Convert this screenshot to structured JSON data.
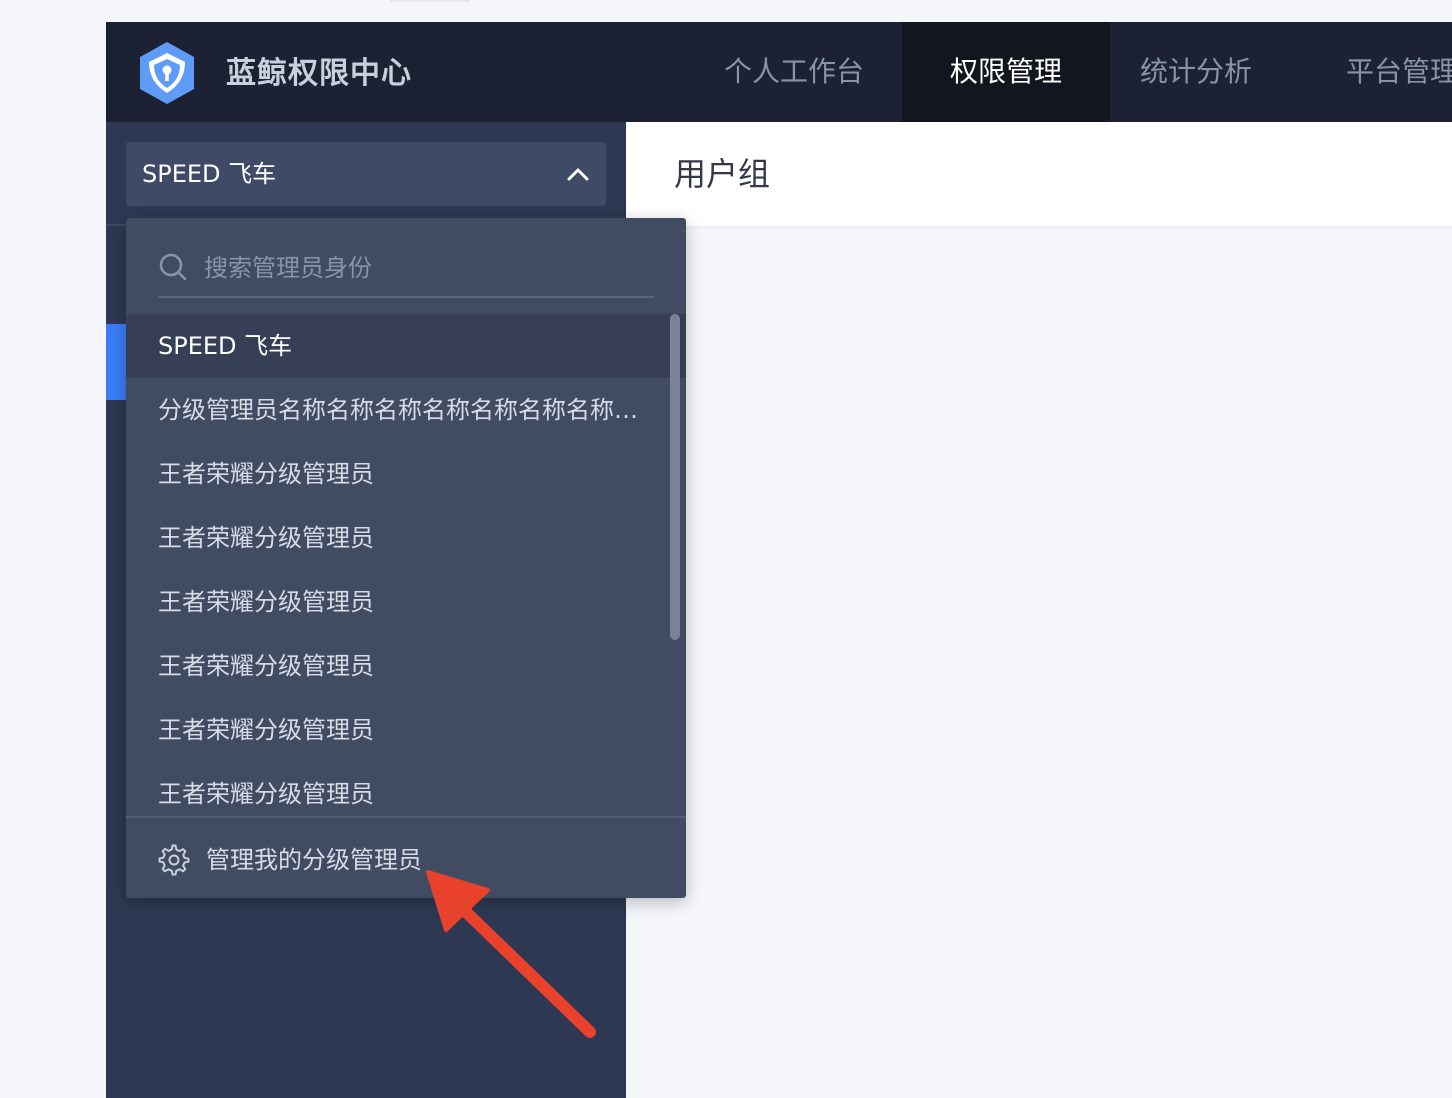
{
  "brand": {
    "title": "蓝鲸权限中心",
    "logo_icon": "shield-icon",
    "logo_color": "#5f9cf8"
  },
  "nav": {
    "items": [
      {
        "label": "个人工作台",
        "active": false
      },
      {
        "label": "权限管理",
        "active": true
      },
      {
        "label": "统计分析",
        "active": false
      },
      {
        "label": "平台管理",
        "active": false
      }
    ]
  },
  "sidebar": {
    "selector_value": "SPEED 飞车",
    "selector_icon": "chevron-up-icon",
    "active_accent": "#3a7cf6"
  },
  "content": {
    "title": "用户组"
  },
  "dropdown": {
    "search_placeholder": "搜索管理员身份",
    "search_value": "",
    "items": [
      {
        "label": "SPEED 飞车",
        "selected": true
      },
      {
        "label": "分级管理员名称名称名称名称名称名称名称名称名称名称",
        "selected": false
      },
      {
        "label": "王者荣耀分级管理员",
        "selected": false
      },
      {
        "label": "王者荣耀分级管理员",
        "selected": false
      },
      {
        "label": "王者荣耀分级管理员",
        "selected": false
      },
      {
        "label": "王者荣耀分级管理员",
        "selected": false
      },
      {
        "label": "王者荣耀分级管理员",
        "selected": false
      },
      {
        "label": "王者荣耀分级管理员",
        "selected": false
      }
    ],
    "footer_label": "管理我的分级管理员",
    "footer_icon": "gear-icon"
  },
  "annotation": {
    "arrow_color": "#e8412c"
  }
}
